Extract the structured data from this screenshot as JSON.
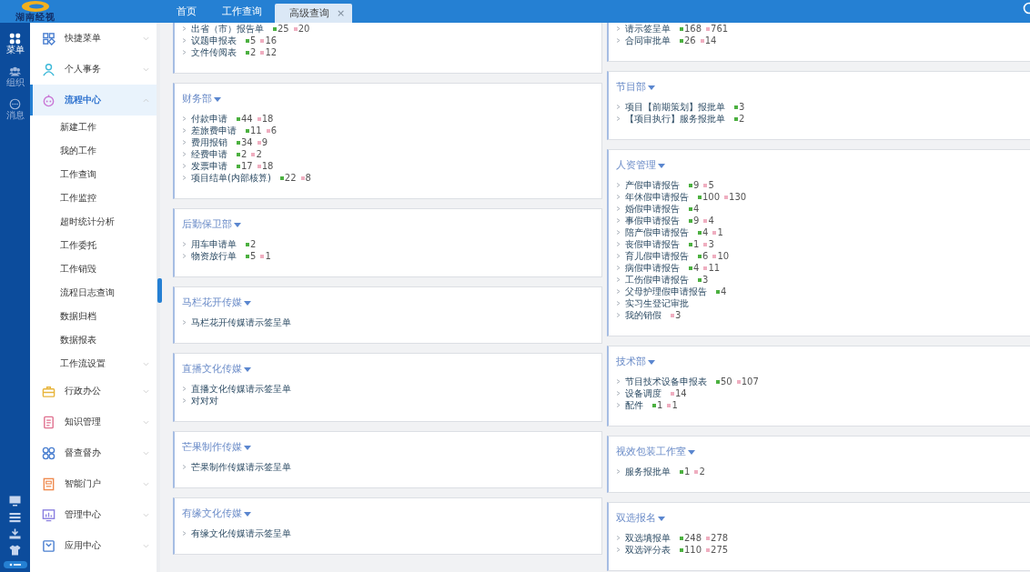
{
  "header": {
    "logo_text": "湖南经视",
    "tabs": [
      {
        "label": "首页",
        "selected": false
      },
      {
        "label": "工作查询",
        "selected": false
      },
      {
        "label": "高级查询",
        "selected": true,
        "close": "×"
      }
    ]
  },
  "rail": {
    "items": [
      {
        "label": "菜单",
        "selected": true
      },
      {
        "label": "组织",
        "selected": false
      },
      {
        "label": "消息",
        "selected": false
      }
    ]
  },
  "sidebar": {
    "items": [
      {
        "label": "快捷菜单",
        "selected": false,
        "expanded": false
      },
      {
        "label": "个人事务",
        "selected": false,
        "expanded": false
      },
      {
        "label": "流程中心",
        "selected": true,
        "expanded": true,
        "children": [
          {
            "label": "新建工作",
            "selected": false
          },
          {
            "label": "我的工作",
            "selected": false
          },
          {
            "label": "工作查询",
            "selected": false
          },
          {
            "label": "工作监控",
            "selected": false
          },
          {
            "label": "超时统计分析",
            "selected": false
          },
          {
            "label": "工作委托",
            "selected": false
          },
          {
            "label": "工作销毁",
            "selected": false
          },
          {
            "label": "流程日志查询",
            "selected": false
          },
          {
            "label": "数据归档",
            "selected": false
          },
          {
            "label": "数据报表",
            "selected": false
          },
          {
            "label": "工作流设置",
            "selected": false,
            "expanded": false
          }
        ]
      },
      {
        "label": "行政办公",
        "selected": false,
        "expanded": false
      },
      {
        "label": "知识管理",
        "selected": false,
        "expanded": false
      },
      {
        "label": "督查督办",
        "selected": false,
        "expanded": false
      },
      {
        "label": "智能门户",
        "selected": false,
        "expanded": false
      },
      {
        "label": "管理中心",
        "selected": false,
        "expanded": false
      },
      {
        "label": "应用中心",
        "selected": false,
        "expanded": false
      }
    ]
  },
  "columns": [
    [
      {
        "rows": [
          {
            "name": "出省（市）报告单",
            "count_a": "25",
            "count_b": "20"
          },
          {
            "name": "议题申报表",
            "count_a": "5",
            "count_b": "16"
          },
          {
            "name": "文件传阅表",
            "count_a": "2",
            "count_b": "12"
          }
        ]
      },
      {
        "title": "财务部",
        "rows": [
          {
            "name": "付款申请",
            "count_a": "44",
            "count_b": "18"
          },
          {
            "name": "差旅费申请",
            "count_a": "11",
            "count_b": "6"
          },
          {
            "name": "费用报销",
            "count_a": "34",
            "count_b": "9"
          },
          {
            "name": "经费申请",
            "count_a": "2",
            "count_b": "2"
          },
          {
            "name": "发票申请",
            "count_a": "17",
            "count_b": "18"
          },
          {
            "name": "项目结单(内部核算)",
            "count_a": "22",
            "count_b": "8"
          }
        ]
      },
      {
        "title": "后勤保卫部",
        "rows": [
          {
            "name": "用车申请单",
            "count_a": "2"
          },
          {
            "name": "物资放行单",
            "count_a": "5",
            "count_b": "1"
          }
        ]
      },
      {
        "title": "马栏花开传媒",
        "rows": [
          {
            "name": "马栏花开传媒请示签呈单"
          }
        ]
      },
      {
        "title": "直播文化传媒",
        "rows": [
          {
            "name": "直播文化传媒请示签呈单"
          },
          {
            "name": "对对对"
          }
        ]
      },
      {
        "title": "芒果制作传媒",
        "rows": [
          {
            "name": "芒果制作传媒请示签呈单"
          }
        ]
      },
      {
        "title": "有缘文化传媒",
        "rows": [
          {
            "name": "有缘文化传媒请示签呈单"
          }
        ]
      }
    ],
    [
      {
        "rows": [
          {
            "name": "请示签呈单",
            "count_a": "168",
            "count_b": "761"
          },
          {
            "name": "合同审批单",
            "count_a": "26",
            "count_b": "14"
          }
        ]
      },
      {
        "title": "节目部",
        "rows": [
          {
            "name": "项目【前期策划】报批单",
            "count_a": "3"
          },
          {
            "name": "【项目执行】服务报批单",
            "count_a": "2"
          }
        ]
      },
      {
        "title": "人资管理",
        "rows": [
          {
            "name": "产假申请报告",
            "count_a": "9",
            "count_b": "5"
          },
          {
            "name": "年休假申请报告",
            "count_a": "100",
            "count_b": "130"
          },
          {
            "name": "婚假申请报告",
            "count_a": "4"
          },
          {
            "name": "事假申请报告",
            "count_a": "9",
            "count_b": "4"
          },
          {
            "name": "陪产假申请报告",
            "count_a": "4",
            "count_b": "1"
          },
          {
            "name": "丧假申请报告",
            "count_a": "1",
            "count_b": "3"
          },
          {
            "name": "育儿假申请报告",
            "count_a": "6",
            "count_b": "10"
          },
          {
            "name": "病假申请报告",
            "count_a": "4",
            "count_b": "11"
          },
          {
            "name": "工伤假申请报告",
            "count_a": "3"
          },
          {
            "name": "父母护理假申请报告",
            "count_a": "4"
          },
          {
            "name": "实习生登记审批"
          },
          {
            "name": "我的销假",
            "count_b": "3"
          }
        ]
      },
      {
        "title": "技术部",
        "rows": [
          {
            "name": "节目技术设备申报表",
            "count_a": "50",
            "count_b": "107"
          },
          {
            "name": "设备调度",
            "count_b": "14"
          },
          {
            "name": "配件",
            "count_a": "1",
            "count_b": "1"
          }
        ]
      },
      {
        "title": "视效包装工作室",
        "rows": [
          {
            "name": "服务报批单",
            "count_a": "1",
            "count_b": "2"
          }
        ]
      },
      {
        "title": "双选报名",
        "rows": [
          {
            "name": "双选填报单",
            "count_a": "248",
            "count_b": "278"
          },
          {
            "name": "双选评分表",
            "count_a": "110",
            "count_b": "275"
          }
        ]
      }
    ]
  ]
}
